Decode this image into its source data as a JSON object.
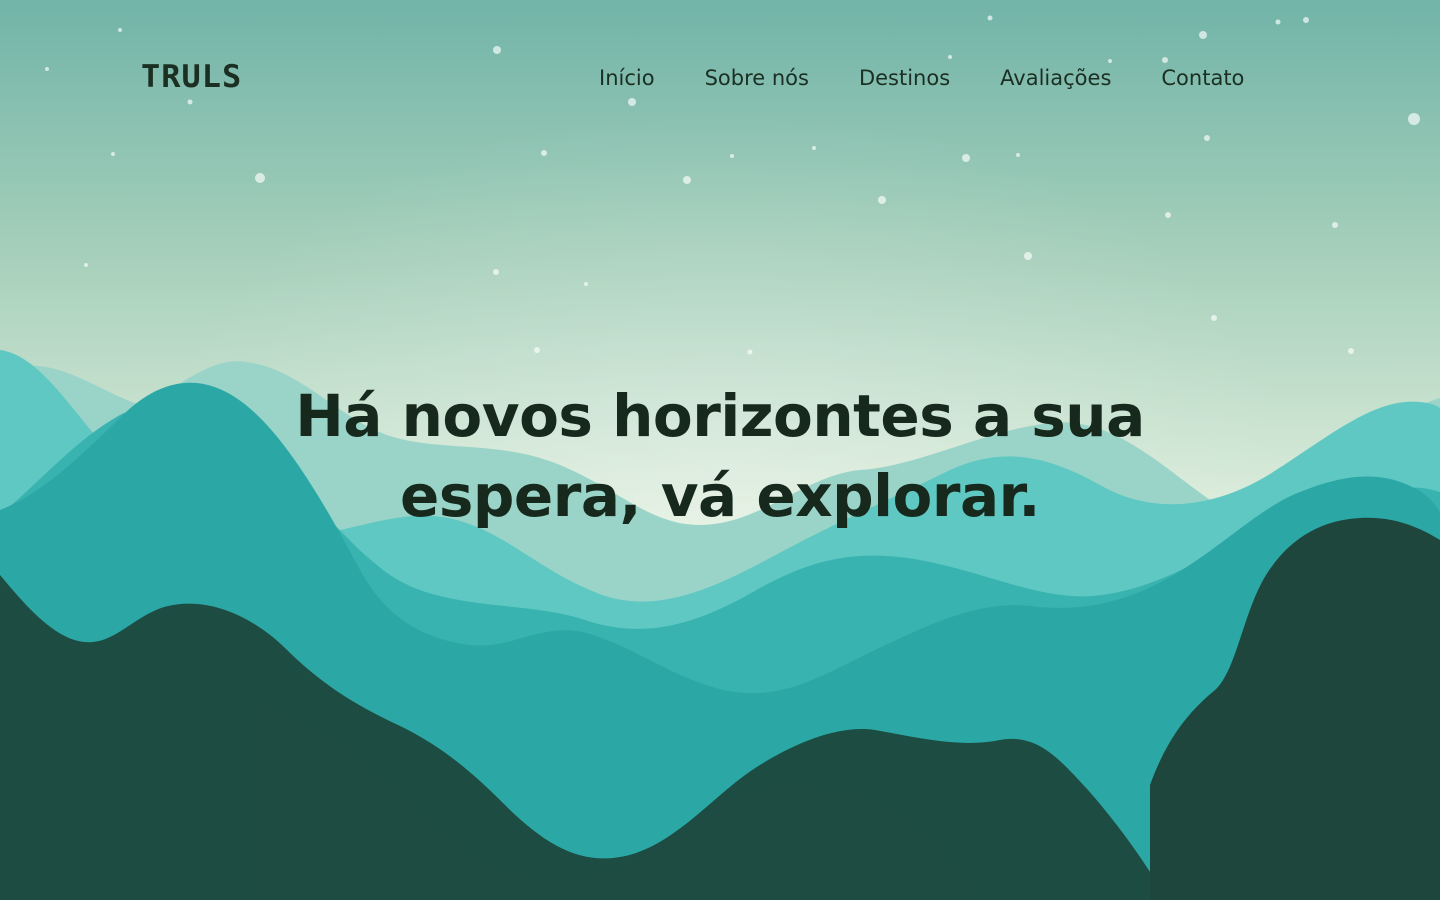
{
  "brand": {
    "logo_text": "TRULS"
  },
  "nav": {
    "items": [
      {
        "label": "Início"
      },
      {
        "label": "Sobre nós"
      },
      {
        "label": "Destinos"
      },
      {
        "label": "Avaliações"
      },
      {
        "label": "Contato"
      }
    ]
  },
  "hero": {
    "headline": "Há novos horizontes a sua espera, vá explorar."
  },
  "theme": {
    "text_dark": "#1b2f22",
    "sky_top": "#7fb9ac",
    "sky_bottom": "#e3f0df",
    "mountain_light": "#8fd2c8",
    "mountain_mid": "#3db8b5",
    "mountain_deep": "#2aa19d",
    "mountain_dark": "#1d4a40"
  }
}
